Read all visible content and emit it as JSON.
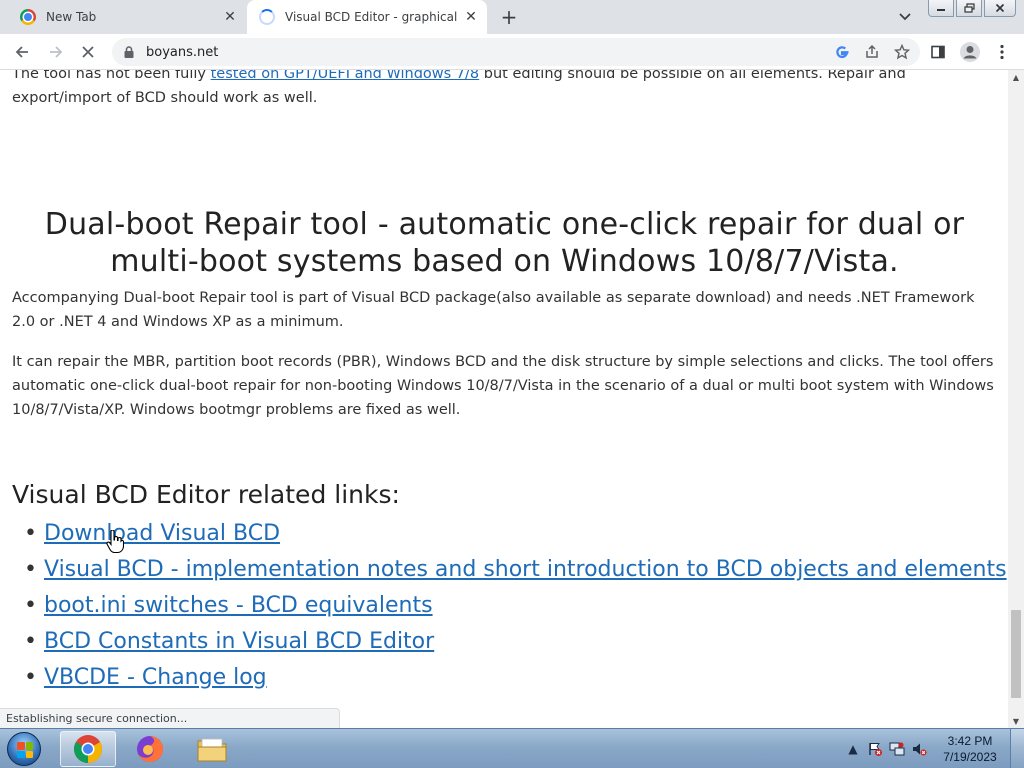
{
  "browser": {
    "tabs": [
      {
        "title": "New Tab"
      },
      {
        "title": "Visual BCD Editor - graphical bcd"
      }
    ],
    "address": "boyans.net",
    "status_text": "Establishing secure connection..."
  },
  "page": {
    "intro_prefix": "The tool has not been fully ",
    "intro_link": "tested on GPT/UEFI and Windows 7/8",
    "intro_suffix": " but editing should be possible on all elements. Repair and export/import of BCD should work as well.",
    "section_heading": "Dual-boot Repair tool - automatic one-click repair for dual or multi-boot systems based on Windows 10/8/7/Vista.",
    "para1": "Accompanying Dual-boot Repair tool is part of Visual BCD package(also available as separate download) and needs .NET Framework 2.0 or .NET 4 and Windows XP as a minimum.",
    "para2": "It can repair the MBR, partition boot records (PBR), Windows BCD and the disk structure by simple selections and clicks. The tool offers automatic one-click dual-boot repair for non-booting Windows 10/8/7/Vista in the scenario of a dual or multi boot system with Windows 10/8/7/Vista/XP. Windows bootmgr problems are fixed as well.",
    "links_heading": "Visual BCD Editor related links:",
    "links": [
      {
        "label": "Download Visual BCD"
      },
      {
        "label": "Visual BCD - implementation notes and short introduction to BCD objects and elements"
      },
      {
        "label": "boot.ini switches - BCD equivalents"
      },
      {
        "label": "BCD Constants in Visual BCD Editor"
      },
      {
        "label": "VBCDE - Change log"
      }
    ]
  },
  "taskbar": {
    "time": "3:42 PM",
    "date": "7/19/2023"
  },
  "colors": {
    "link": "#1e6bb8",
    "tab_strip": "#dee1e6",
    "taskbar": "#8aa8c8"
  }
}
